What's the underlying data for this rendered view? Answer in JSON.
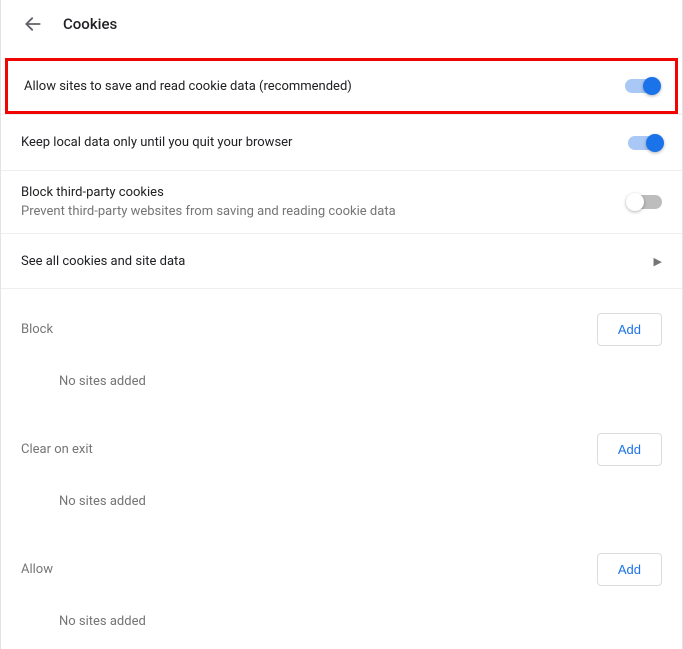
{
  "header": {
    "title": "Cookies"
  },
  "settings": {
    "allow": {
      "label": "Allow sites to save and read cookie data (recommended)",
      "enabled": true,
      "highlighted": true
    },
    "keepLocal": {
      "label": "Keep local data only until you quit your browser",
      "enabled": true
    },
    "blockThird": {
      "label": "Block third-party cookies",
      "sub": "Prevent third-party websites from saving and reading cookie data",
      "enabled": false
    },
    "seeAll": {
      "label": "See all cookies and site data"
    }
  },
  "sections": {
    "block": {
      "label": "Block",
      "button": "Add",
      "empty": "No sites added"
    },
    "clear": {
      "label": "Clear on exit",
      "button": "Add",
      "empty": "No sites added"
    },
    "allow": {
      "label": "Allow",
      "button": "Add",
      "empty": "No sites added"
    }
  }
}
